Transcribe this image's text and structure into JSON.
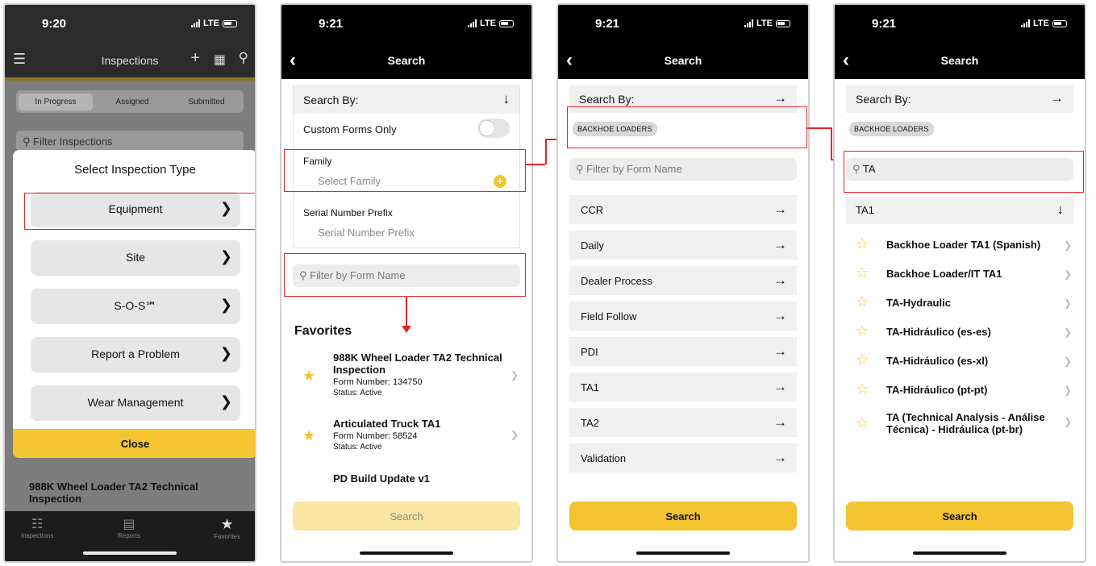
{
  "screen1": {
    "time": "9:20",
    "network": "LTE",
    "header_title": "Inspections",
    "tabs": [
      "In Progress",
      "Assigned",
      "Submitted"
    ],
    "filter_placeholder": "Filter Inspections",
    "sheet_title": "Select Inspection Type",
    "options": [
      "Equipment",
      "Site",
      "S-O-S℠",
      "Report a Problem",
      "Wear Management"
    ],
    "close_label": "Close",
    "bg_item_title": "988K Wheel Loader TA2 Technical Inspection",
    "bottom_nav": [
      "Inspections",
      "Reports",
      "Favorites"
    ]
  },
  "screen2": {
    "time": "9:21",
    "network": "LTE",
    "header_title": "Search",
    "search_by_label": "Search By:",
    "custom_forms_label": "Custom Forms Only",
    "family_label": "Family",
    "family_placeholder": "Select Family",
    "serial_label": "Serial Number Prefix",
    "serial_placeholder": "Serial Number Prefix",
    "filter_placeholder": "Filter by Form Name",
    "favorites_heading": "Favorites",
    "favorites": [
      {
        "title": "988K Wheel Loader TA2 Technical Inspection",
        "form_number": "Form Number: 134750",
        "status": "Status: Active"
      },
      {
        "title": "Articulated Truck TA1",
        "form_number": "Form Number: 58524",
        "status": "Status: Active"
      },
      {
        "title": "PD Build Update v1",
        "form_number": "",
        "status": ""
      }
    ],
    "search_button": "Search"
  },
  "screen3": {
    "time": "9:21",
    "network": "LTE",
    "header_title": "Search",
    "search_by_label": "Search By:",
    "chip": "BACKHOE LOADERS",
    "filter_placeholder": "Filter by Form Name",
    "categories": [
      "CCR",
      "Daily",
      "Dealer Process",
      "Field Follow",
      "PDI",
      "TA1",
      "TA2",
      "Validation"
    ],
    "search_button": "Search"
  },
  "screen4": {
    "time": "9:21",
    "network": "LTE",
    "header_title": "Search",
    "search_by_label": "Search By:",
    "chip": "BACKHOE LOADERS",
    "filter_value": "TA",
    "group_label": "TA1",
    "results": [
      "Backhoe Loader TA1 (Spanish)",
      "Backhoe Loader/IT TA1",
      "TA-Hydraulic",
      "TA-Hidráulico (es-es)",
      "TA-Hidráulico (es-xl)",
      "TA-Hidráulico (pt-pt)",
      "TA (Technical Analysis - Análise Técnica) - Hidráulica (pt-br)"
    ],
    "search_button": "Search"
  },
  "colors": {
    "accent": "#f4c430",
    "highlight": "#e8232a",
    "header": "#000000"
  }
}
